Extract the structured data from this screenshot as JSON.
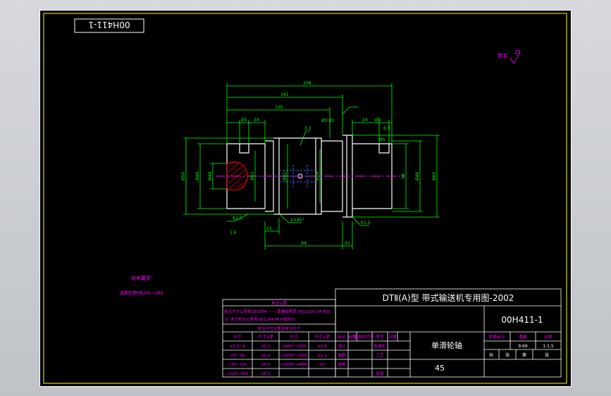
{
  "colors": {
    "background": "#000000",
    "border": "#ffff00",
    "part_outline": "#ffffff",
    "dimension": "#00ff00",
    "center_line": "#ff00ff",
    "hatch": "#ff0000",
    "text_magenta": "#ff00ff",
    "hidden_line": "#4060ff"
  },
  "stamp_code": "00H411-1",
  "roughness_other": "其余",
  "roughness_value": "25",
  "dimensions": {
    "total_length": "208",
    "length_141": "141",
    "length_125": "125",
    "d25_left": "Ø5",
    "d24_left": "24",
    "tol_right": "Ø0.03",
    "d25_right": "Ø5",
    "d24_right": "24",
    "d8_right": "Ø5",
    "d_left_outer": "Ø50",
    "d_left_2": "Ø48",
    "d_left_3": "M48",
    "d_center_1": "Ø62",
    "d_center_2": "Ø82",
    "d_center_3": "Ø78",
    "d_right_1": "58",
    "d_right_2": "Ø48",
    "d_right_3": "Ø60",
    "chamfer": "2×45°",
    "r_left": "R1.5",
    "r_right": "R1.5",
    "len_94": "94",
    "len_41": "41",
    "len_15": "15",
    "roughness_1": "3.2",
    "roughness_2": "6.3",
    "roughness_3": "1.6"
  },
  "tech_notes": {
    "title": "技术要求",
    "line1": "调质处理HB241～269"
  },
  "tolerance_table": {
    "header_top": "未注公差",
    "row_note_1": "未注尺寸公差按GB1804 —— 普通级精度 HB12000-34 820",
    "row_note_2": "注: 未注形位公差按GB1184-96 K级执行",
    "sub_header": "未注尺寸公差及未注尺寸",
    "columns": [
      "尺寸",
      "尺寸公差",
      "尺寸",
      "尺寸公差"
    ],
    "rows": [
      [
        "≥0.5～6",
        "±0.1",
        ">400～1000",
        "±0.8"
      ],
      [
        ">6～30",
        "±0.2",
        ">1000～2000",
        "±1.2"
      ],
      [
        ">30～120",
        "±0.3",
        ">2000～4000",
        "±2"
      ],
      [
        ">120～400",
        "±0.5",
        "",
        ""
      ]
    ]
  },
  "title_block": {
    "project": "DTⅡ(A)型 带式输送机专用图-2002",
    "drawing_no": "00H411-1",
    "part_name": "单滑轮轴",
    "material": "45",
    "revision_row": [
      "标记",
      "处数",
      "更改文件号",
      "签字",
      "日期"
    ],
    "roles": [
      "设计",
      "制图",
      "审核",
      "工艺",
      "批准"
    ],
    "check_mark": "标准化",
    "stage_header": [
      "阶段标记",
      "重量",
      "比例"
    ],
    "weight": "9.69",
    "scale": "1:1.5",
    "sheet_row": [
      "共",
      "张",
      "第",
      "张"
    ]
  }
}
